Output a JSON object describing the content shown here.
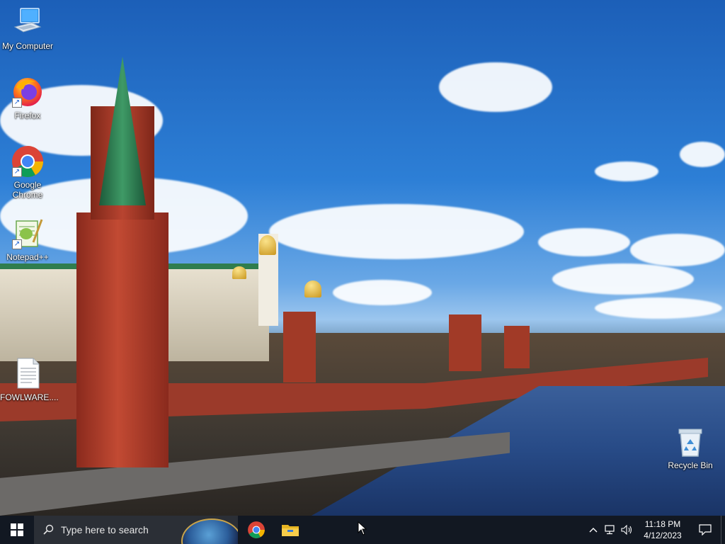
{
  "desktop": {
    "icons": [
      {
        "label": "My Computer",
        "icon": "computer-icon"
      },
      {
        "label": "Firefox",
        "icon": "firefox-icon"
      },
      {
        "label": "Google Chrome",
        "icon": "chrome-icon"
      },
      {
        "label": "Notepad++",
        "icon": "notepadpp-icon"
      },
      {
        "label": "FOWLWARE....",
        "icon": "text-file-icon"
      },
      {
        "label": "Recycle Bin",
        "icon": "recycle-bin-icon"
      }
    ]
  },
  "taskbar": {
    "start_icon": "windows-logo-icon",
    "search_placeholder": "Type here to search",
    "pinned_apps": [
      {
        "name": "Google Chrome",
        "icon": "chrome-icon"
      },
      {
        "name": "File Explorer",
        "icon": "folder-icon"
      }
    ],
    "tray": {
      "chevron": "chevron-up-icon",
      "network": "network-icon",
      "volume": "volume-icon",
      "time": "11:18 PM",
      "date": "4/12/2023",
      "notification": "notification-icon"
    }
  },
  "colors": {
    "taskbar_bg": "#121822",
    "search_bg": "#2b2f36",
    "windows_blue": "#0078d7"
  }
}
